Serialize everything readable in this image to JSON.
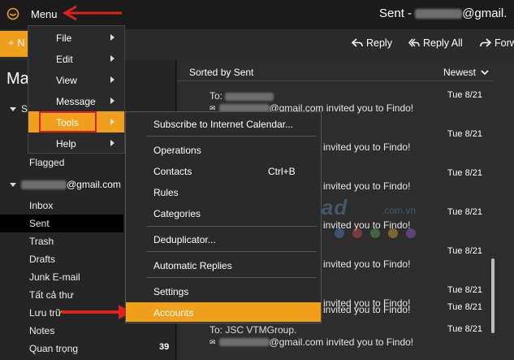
{
  "window": {
    "menu_label": "Menu",
    "title_prefix": "Sent - ",
    "title_suffix": "@gmail."
  },
  "toolbar": {
    "new_label": "+ N",
    "reply_label": "Reply",
    "reply_all_label": "Reply All",
    "forward_label": "Forw"
  },
  "sidebar": {
    "title": "Ma",
    "folder_s": "S",
    "flagged": "Flagged",
    "account_suffix": "@gmail.com",
    "folders": [
      "Inbox",
      "Sent",
      "Trash",
      "Drafts",
      "Junk E-mail",
      "Tất cả thư",
      "Lưu trữ",
      "Notes",
      "Quan trọng"
    ],
    "quan_trong_count": "39"
  },
  "list": {
    "sorted_label": "Sorted by Sent",
    "newest_label": "Newest",
    "messages": [
      {
        "from": "To:",
        "snippet_suffix": "@gmail.com invited you to Findo!",
        "date": "Tue 8/21"
      },
      {
        "from": "",
        "snippet_suffix": "invited you to Findo!",
        "date": "Tue 8/21"
      },
      {
        "from": "",
        "snippet_suffix": "invited you to Findo!",
        "date": "Tue 8/21"
      },
      {
        "from": "",
        "snippet_suffix": "invited you to Findo!",
        "date": "Tue 8/21"
      },
      {
        "from": "",
        "snippet_suffix": "invited you to Findo!",
        "date": "Tue 8/21"
      },
      {
        "from": "",
        "snippet_suffix": "invited you to Findo!",
        "date": "Tue 8/21"
      },
      {
        "from": "",
        "snippet_suffix": "invited you to Findo!",
        "date": "Tue 8/21"
      },
      {
        "from": "To: JSC VTMGroup.",
        "snippet_suffix": "@gmail.com invited you to Findo!",
        "date": "Tue 8/21"
      }
    ]
  },
  "main_menu": {
    "items": [
      {
        "label": "File"
      },
      {
        "label": "Edit"
      },
      {
        "label": "View"
      },
      {
        "label": "Message"
      },
      {
        "label": "Tools"
      },
      {
        "label": "Help"
      }
    ],
    "active_index": 4
  },
  "tools_submenu": {
    "items": [
      {
        "label": "Subscribe to Internet Calendar..."
      },
      {
        "label": "Operations"
      },
      {
        "label": "Contacts",
        "shortcut": "Ctrl+B"
      },
      {
        "label": "Rules"
      },
      {
        "label": "Categories"
      },
      {
        "label": "Deduplicator..."
      },
      {
        "label": "Automatic Replies"
      },
      {
        "label": "Settings"
      },
      {
        "label": "Accounts"
      }
    ],
    "active_label": "Accounts"
  },
  "watermark": {
    "text": "Download",
    "suffix": ".com.vn"
  },
  "colors": {
    "accent": "#f0a01c",
    "annotation_red": "#e02020",
    "background": "#1e1e1e"
  }
}
